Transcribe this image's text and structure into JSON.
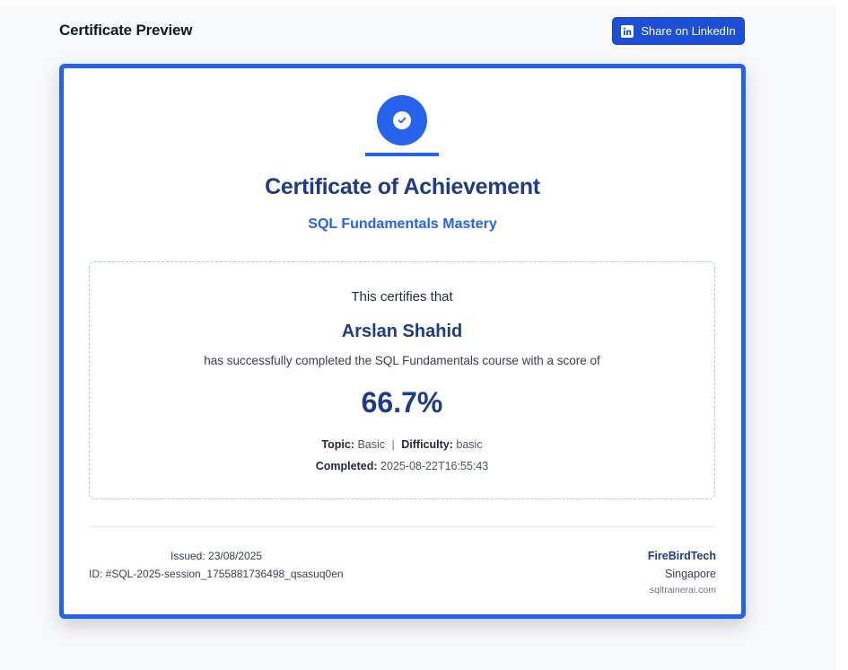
{
  "header": {
    "title": "Certificate Preview",
    "share_label": "Share on LinkedIn"
  },
  "certificate": {
    "heading": "Certificate of Achievement",
    "course_title": "SQL Fundamentals Mastery",
    "certifies_text": "This certifies that",
    "recipient": "Arslan Shahid",
    "completion_text": "has successfully completed the SQL Fundamentals course with a score of",
    "score": "66.7%",
    "topic_label": "Topic:",
    "topic_value": "Basic",
    "separator": "|",
    "difficulty_label": "Difficulty:",
    "difficulty_value": "basic",
    "completed_label": "Completed:",
    "completed_value": "2025-08-22T16:55:43",
    "issued": "Issued: 23/08/2025",
    "id": "ID: #SQL-2025-session_1755881736498_qsasuq0en",
    "org_name": "FireBirdTech",
    "org_location": "Singapore",
    "org_site": "sqltrainerai.com"
  },
  "colors": {
    "accent": "#2563eb",
    "heading": "#1e3a8a",
    "button": "#1d4ed8"
  },
  "icons": {
    "share_icon": "linkedin-icon",
    "badge_icon": "check-circle-icon"
  }
}
